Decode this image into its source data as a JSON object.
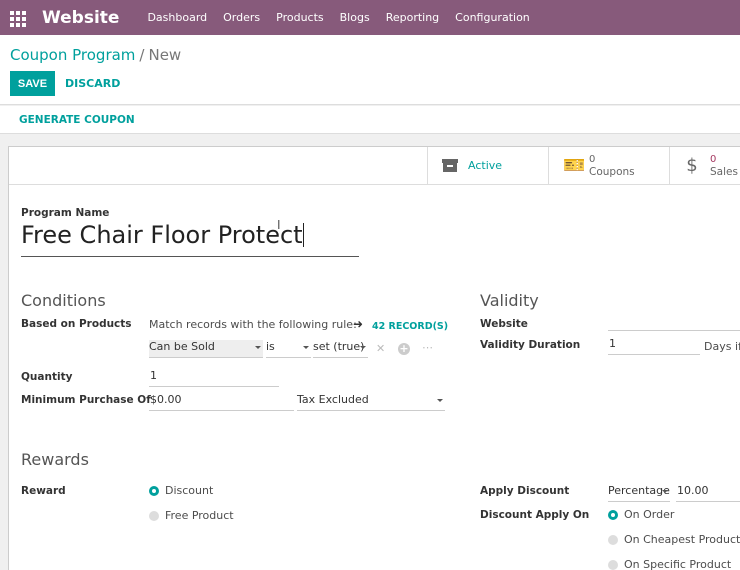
{
  "navbar": {
    "brand": "Website",
    "menu": [
      "Dashboard",
      "Orders",
      "Products",
      "Blogs",
      "Reporting",
      "Configuration"
    ]
  },
  "breadcrumb": {
    "parent": "Coupon Program",
    "separator": "/",
    "current": "New"
  },
  "actions": {
    "save": "SAVE",
    "discard": "DISCARD"
  },
  "statusbar": {
    "generate": "GENERATE COUPON"
  },
  "stats": {
    "active": "Active",
    "coupons_count": "0",
    "coupons_label": "Coupons",
    "sales_count": "0",
    "sales_label": "Sales",
    "sales_symbol": "$"
  },
  "program": {
    "label": "Program Name",
    "value": "Free Chair Floor Protect"
  },
  "conditions": {
    "title": "Conditions",
    "based_on_label": "Based on Products",
    "match_text": "Match records with the following rule:",
    "records_link": "42 RECORD(S)",
    "rule_field": "Can be Sold",
    "rule_operator": "is",
    "rule_value": "set (true)",
    "quantity_label": "Quantity",
    "quantity_value": "1",
    "min_purchase_label": "Minimum Purchase Of",
    "min_purchase_value": "$0.00",
    "tax_option": "Tax Excluded"
  },
  "validity": {
    "title": "Validity",
    "website_label": "Website",
    "website_value": "",
    "duration_label": "Validity Duration",
    "duration_value": "1",
    "duration_unit": "Days if"
  },
  "rewards": {
    "title": "Rewards",
    "reward_label": "Reward",
    "reward_options": [
      {
        "label": "Discount",
        "checked": true
      },
      {
        "label": "Free Product",
        "checked": false
      }
    ],
    "apply_discount_label": "Apply Discount",
    "apply_discount_type": "Percentage",
    "apply_discount_value": "10.00",
    "apply_on_label": "Discount Apply On",
    "apply_on_options": [
      {
        "label": "On Order",
        "checked": true
      },
      {
        "label": "On Cheapest Product",
        "checked": false
      },
      {
        "label": "On Specific Product",
        "checked": false
      }
    ]
  },
  "colors": {
    "navbar": "#875a7b",
    "accent": "#00a09d",
    "sales": "#a53860"
  }
}
